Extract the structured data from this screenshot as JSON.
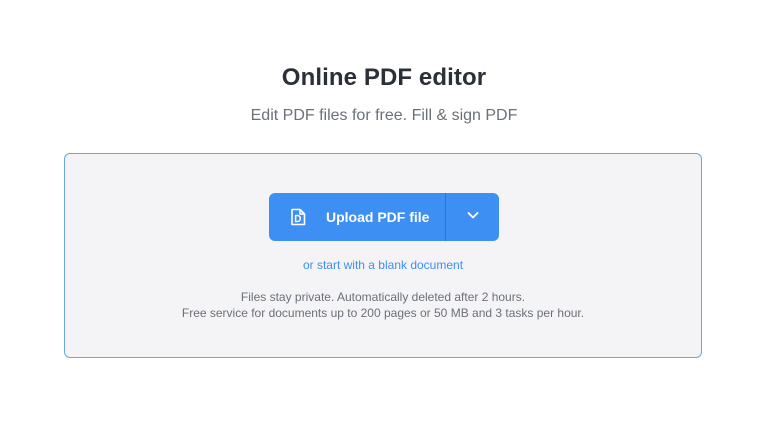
{
  "header": {
    "title": "Online PDF editor",
    "subtitle": "Edit PDF files for free. Fill & sign PDF"
  },
  "upload": {
    "button_label": "Upload PDF file",
    "button_icon": "pdf-document-icon",
    "dropdown_icon": "chevron-down-icon",
    "blank_link": "or start with a blank document"
  },
  "notes": {
    "line1": "Files stay private. Automatically deleted after 2 hours.",
    "line2": "Free service for documents up to 200 pages or 50 MB and 3 tasks per hour."
  },
  "colors": {
    "accent": "#3d8ff4",
    "dropzone_border": "#6aa6e6",
    "dropzone_bg": "#f4f4f6",
    "title": "#2b3038",
    "muted_text": "#6b7079"
  }
}
